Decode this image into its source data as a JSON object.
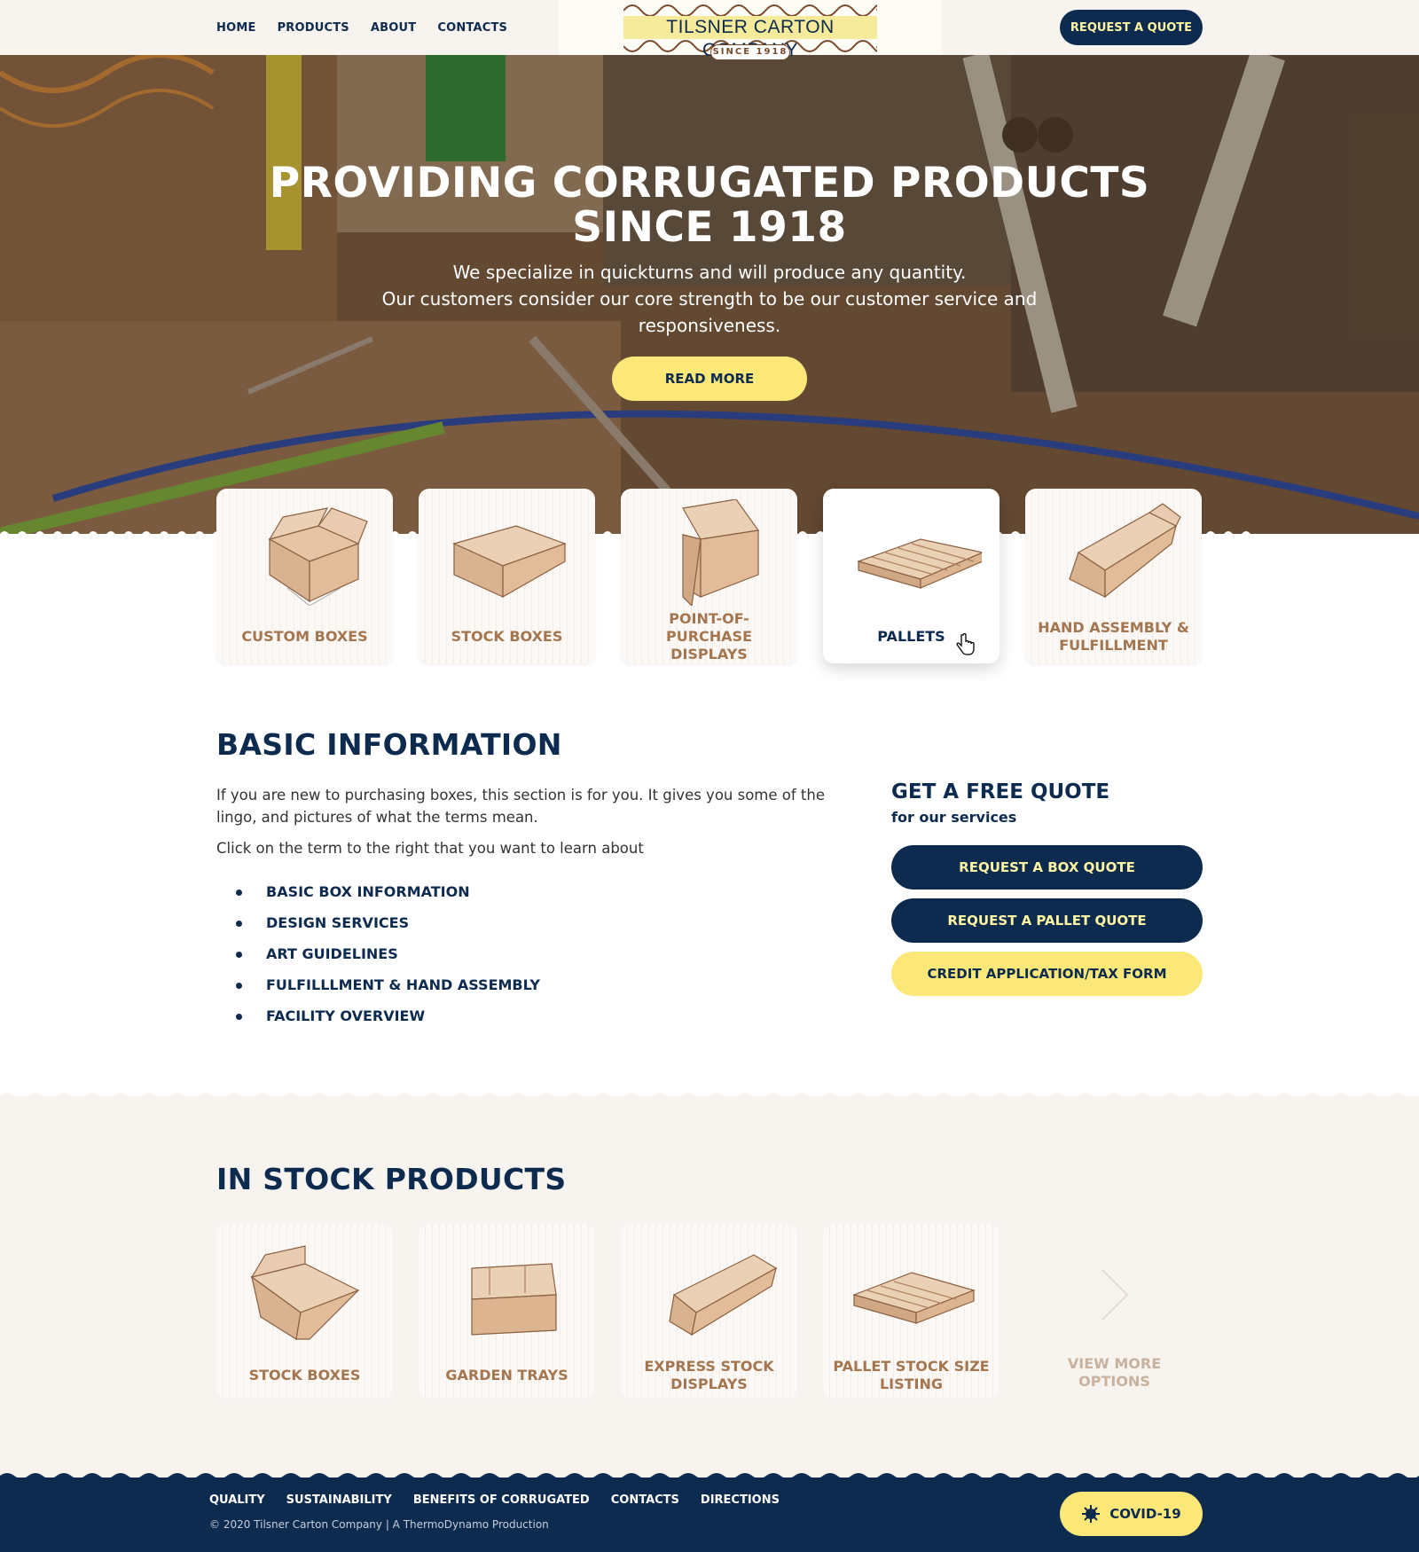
{
  "nav": {
    "items": [
      "HOME",
      "PRODUCTS",
      "ABOUT",
      "CONTACTS"
    ],
    "quote_button": "REQUEST A QUOTE"
  },
  "logo": {
    "title": "TILSNER CARTON COMPANY",
    "since": "SINCE 1918"
  },
  "hero": {
    "title": "PROVIDING CORRUGATED PRODUCTS SINCE 1918",
    "subtitle_line1": "We specialize in quickturns and will produce any quantity.",
    "subtitle_line2": "Our customers consider our core strength to be our customer service and responsiveness.",
    "read_more": "READ MORE"
  },
  "categories": [
    {
      "label": "CUSTOM BOXES",
      "icon": "open-box-icon"
    },
    {
      "label": "STOCK BOXES",
      "icon": "flat-box-icon"
    },
    {
      "label": "POINT-OF-PURCHASE DISPLAYS",
      "icon": "display-box-icon"
    },
    {
      "label": "PALLETS",
      "icon": "pallet-icon"
    },
    {
      "label": "HAND ASSEMBLY & FULFILLMENT",
      "icon": "folded-box-icon"
    }
  ],
  "basic_info": {
    "heading": "BASIC INFORMATION",
    "para1": "If you are new to purchasing boxes, this section is for you. It gives you some of the lingo, and pictures of what the terms mean.",
    "para2": "Click on the term to the right that you want to learn about",
    "topics": [
      "BASIC BOX INFORMATION",
      "DESIGN SERVICES",
      "ART GUIDELINES",
      "FULFILLLMENT & HAND ASSEMBLY",
      "FACILITY OVERVIEW"
    ]
  },
  "free_quote": {
    "heading": "GET A FREE QUOTE",
    "subheading": "for our services",
    "buttons": [
      "REQUEST A BOX QUOTE",
      "REQUEST A PALLET QUOTE",
      "CREDIT APPLICATION/TAX FORM"
    ]
  },
  "in_stock": {
    "heading": "IN STOCK PRODUCTS",
    "items": [
      {
        "label": "STOCK BOXES",
        "icon": "open-box-icon"
      },
      {
        "label": "GARDEN TRAYS",
        "icon": "tray-icon"
      },
      {
        "label": "EXPRESS STOCK DISPLAYS",
        "icon": "display-icon"
      },
      {
        "label": "PALLET STOCK SIZE LISTING",
        "icon": "pallet-icon"
      }
    ],
    "view_more": "VIEW MORE OPTIONS"
  },
  "footer": {
    "links": [
      "QUALITY",
      "SUSTAINABILITY",
      "BENEFITS OF CORRUGATED",
      "CONTACTS",
      "DIRECTIONS"
    ],
    "copyright": "© 2020 Tilsner Carton Company | A ThermoDynamo Production",
    "covid_button": "COVID-19"
  },
  "colors": {
    "navy": "#0d2a4f",
    "yellow": "#fbe878",
    "tan": "#a47650",
    "cream": "#f7f3ef"
  }
}
